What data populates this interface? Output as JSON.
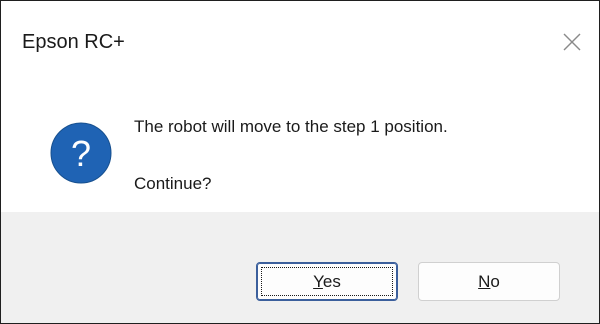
{
  "window": {
    "title": "Epson RC+",
    "close_icon": "close-icon"
  },
  "message": {
    "icon": "question-icon",
    "icon_color": "#1f63b4",
    "line1": "The robot will move to the step 1 position.",
    "line2": "Continue?"
  },
  "buttons": {
    "yes": {
      "mnemonic": "Y",
      "rest": "es"
    },
    "no": {
      "mnemonic": "N",
      "rest": "o"
    }
  },
  "colors": {
    "footer_background": "#f0f0f0",
    "default_button_border": "#3b5f9c"
  }
}
